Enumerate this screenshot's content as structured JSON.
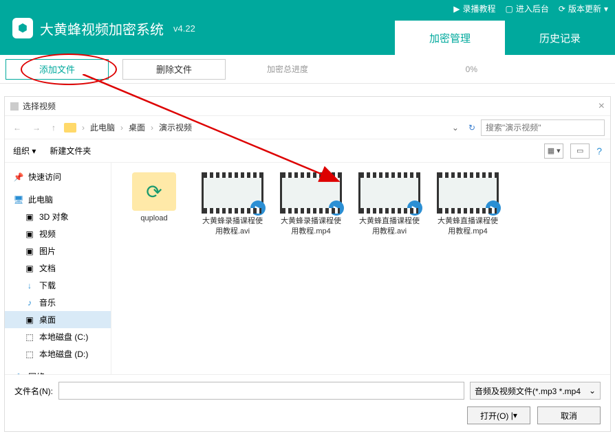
{
  "header": {
    "title": "大黄蜂视频加密系统",
    "version": "v4.22",
    "links": {
      "tutorial": "录播教程",
      "backend": "进入后台",
      "update": "版本更新"
    },
    "tabs": {
      "encrypt": "加密管理",
      "history": "历史记录"
    }
  },
  "toolbar": {
    "add": "添加文件",
    "delete": "删除文件",
    "progress_label": "加密总进度",
    "progress_value": "0%"
  },
  "dialog": {
    "title": "选择视频",
    "breadcrumb": [
      "此电脑",
      "桌面",
      "演示视频"
    ],
    "search_placeholder": "搜索\"演示视频\"",
    "toolbar": {
      "organize": "组织",
      "new_folder": "新建文件夹"
    },
    "sidebar": {
      "quick": "快速访问",
      "this_pc": "此电脑",
      "items": [
        "3D 对象",
        "视频",
        "图片",
        "文档",
        "下载",
        "音乐",
        "桌面",
        "本地磁盘 (C:)",
        "本地磁盘 (D:)"
      ],
      "network": "网络"
    },
    "files": [
      {
        "type": "folder",
        "name": "qupload"
      },
      {
        "type": "video",
        "name": "大黄蜂录播课程使用教程.avi"
      },
      {
        "type": "video",
        "name": "大黄蜂录播课程使用教程.mp4"
      },
      {
        "type": "video",
        "name": "大黄蜂直播课程使用教程.avi"
      },
      {
        "type": "video",
        "name": "大黄蜂直播课程使用教程.mp4"
      }
    ],
    "footer": {
      "filename_label": "文件名(N):",
      "filter": "音频及视频文件(*.mp3 *.mp4",
      "open": "打开(O)",
      "cancel": "取消"
    }
  }
}
